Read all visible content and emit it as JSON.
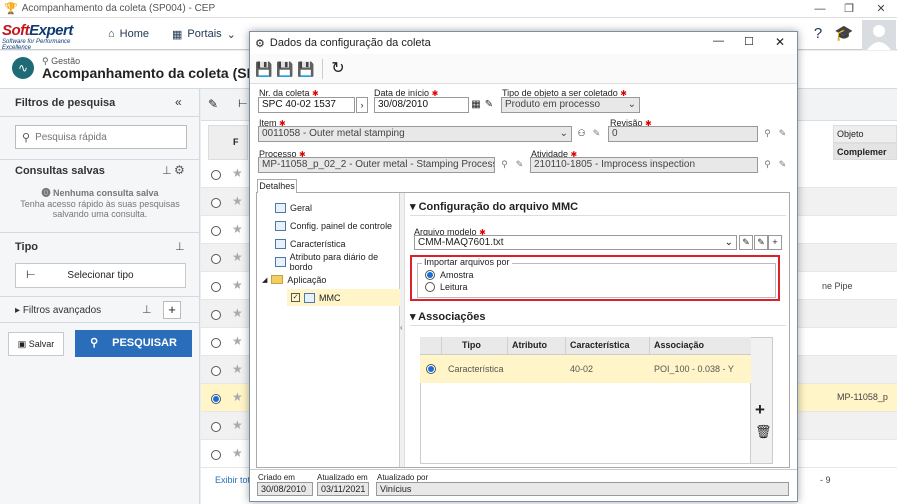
{
  "window": {
    "title": "Acompanhamento da coleta (SP004) - CEP"
  },
  "app": {
    "brand_main": "Soft",
    "brand_accent": "Expert",
    "brand_tagline": "Software for Performance Excellence",
    "nav_home": "Home",
    "nav_portals": "Portais"
  },
  "page": {
    "breadcrumb": "Gestão",
    "title": "Acompanhamento da coleta (SP004)"
  },
  "left": {
    "filters_title": "Filtros de pesquisa",
    "search_placeholder": "Pesquisa rápida",
    "saved_title": "Consultas salvas",
    "saved_empty": "Nenhuma consulta salva",
    "saved_hint": "Tenha acesso rápido às suas pesquisas salvando uma consulta.",
    "type_title": "Tipo",
    "select_type": "Selecionar tipo",
    "advanced": "Filtros avançados",
    "save": "Salvar",
    "search": "PESQUISAR",
    "show_all": "Exibir tot"
  },
  "bg": {
    "col_f": "F",
    "col_obj": "Objeto",
    "col_comp": "Complemer",
    "cell_pipe": "ne Pipe",
    "cell_mp": "MP-11058_p",
    "pager": "- 9"
  },
  "dialog": {
    "title": "Dados da configuração da coleta",
    "fields": {
      "nr_label": "Nr. da coleta",
      "nr_value": "SPC 40-02 1537",
      "start_label": "Data de início",
      "start_value": "30/08/2010",
      "type_label": "Tipo de objeto a ser coletado",
      "type_value": "Produto em processo",
      "item_label": "Item",
      "item_value": "0011058 - Outer metal stamping",
      "rev_label": "Revisão",
      "rev_value": "0",
      "proc_label": "Processo",
      "proc_value": "MP-11058_p_02_2 - Outer metal - Stamping Process Flo",
      "act_label": "Atividade",
      "act_value": "210110-1805 - Improcess inspection"
    },
    "tab_details": "Detalhes",
    "tree": [
      "Geral",
      "Config. painel de controle",
      "Característica",
      "Atributo para diário de bordo",
      "Aplicação",
      "MMC"
    ],
    "mmc_section": "Configuração do arquivo MMC",
    "model_label": "Arquivo modelo",
    "model_value": "CMM-MAQ7601.txt",
    "import_legend": "Importar arquivos por",
    "opt_sample": "Amostra",
    "opt_reading": "Leitura",
    "assoc_section": "Associações",
    "assoc_headers": [
      "Tipo",
      "Atributo",
      "Característica",
      "Associação"
    ],
    "assoc_row": [
      "Característica",
      "",
      "40-02",
      "POI_100 - 0.038 - Y"
    ],
    "footer": {
      "created_label": "Criado em",
      "created_value": "30/08/2010",
      "updated_label": "Atualizado em",
      "updated_value": "03/11/2021",
      "updated_by_label": "Atualizado por",
      "updated_by_value": "Vinícius"
    }
  },
  "colors": {
    "accent": "#2a6ebb",
    "highlight": "#d9222a",
    "selected_row": "#fff5c8"
  }
}
